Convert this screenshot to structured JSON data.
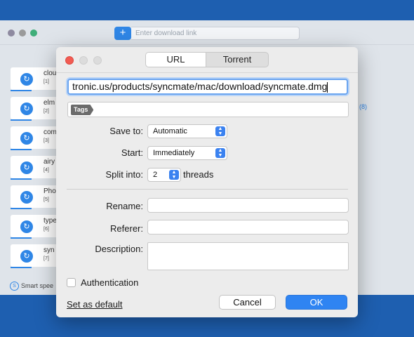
{
  "background": {
    "search_placeholder": "Enter download link",
    "add_symbol": "+",
    "downloads": [
      {
        "name": "clou",
        "tag": "[1]"
      },
      {
        "name": "elm",
        "tag": "[2]"
      },
      {
        "name": "com",
        "tag": "[3]"
      },
      {
        "name": "airy",
        "tag": "[4]"
      },
      {
        "name": "Pho",
        "tag": "[5]"
      },
      {
        "name": "type",
        "tag": "[6]"
      },
      {
        "name": "syn",
        "tag": "[7]"
      }
    ],
    "right_tag": "(8)",
    "smart_speed_label": "Smart spee"
  },
  "dialog": {
    "tabs": {
      "url": "URL",
      "torrent": "Torrent"
    },
    "url_value": "tronic.us/products/syncmate/mac/download/syncmate.dmg",
    "tags_chip": "Tags",
    "save_to": {
      "label": "Save to:",
      "value": "Automatic"
    },
    "start": {
      "label": "Start:",
      "value": "Immediately"
    },
    "split": {
      "label": "Split into:",
      "value": "2",
      "suffix": "threads"
    },
    "rename_label": "Rename:",
    "referer_label": "Referer:",
    "description_label": "Description:",
    "authentication_label": "Authentication",
    "set_default": "Set as default",
    "cancel": "Cancel",
    "ok": "OK"
  },
  "colors": {
    "accent": "#2f84f2",
    "desktop": "#1e5fb0",
    "close": "#f25b52"
  }
}
